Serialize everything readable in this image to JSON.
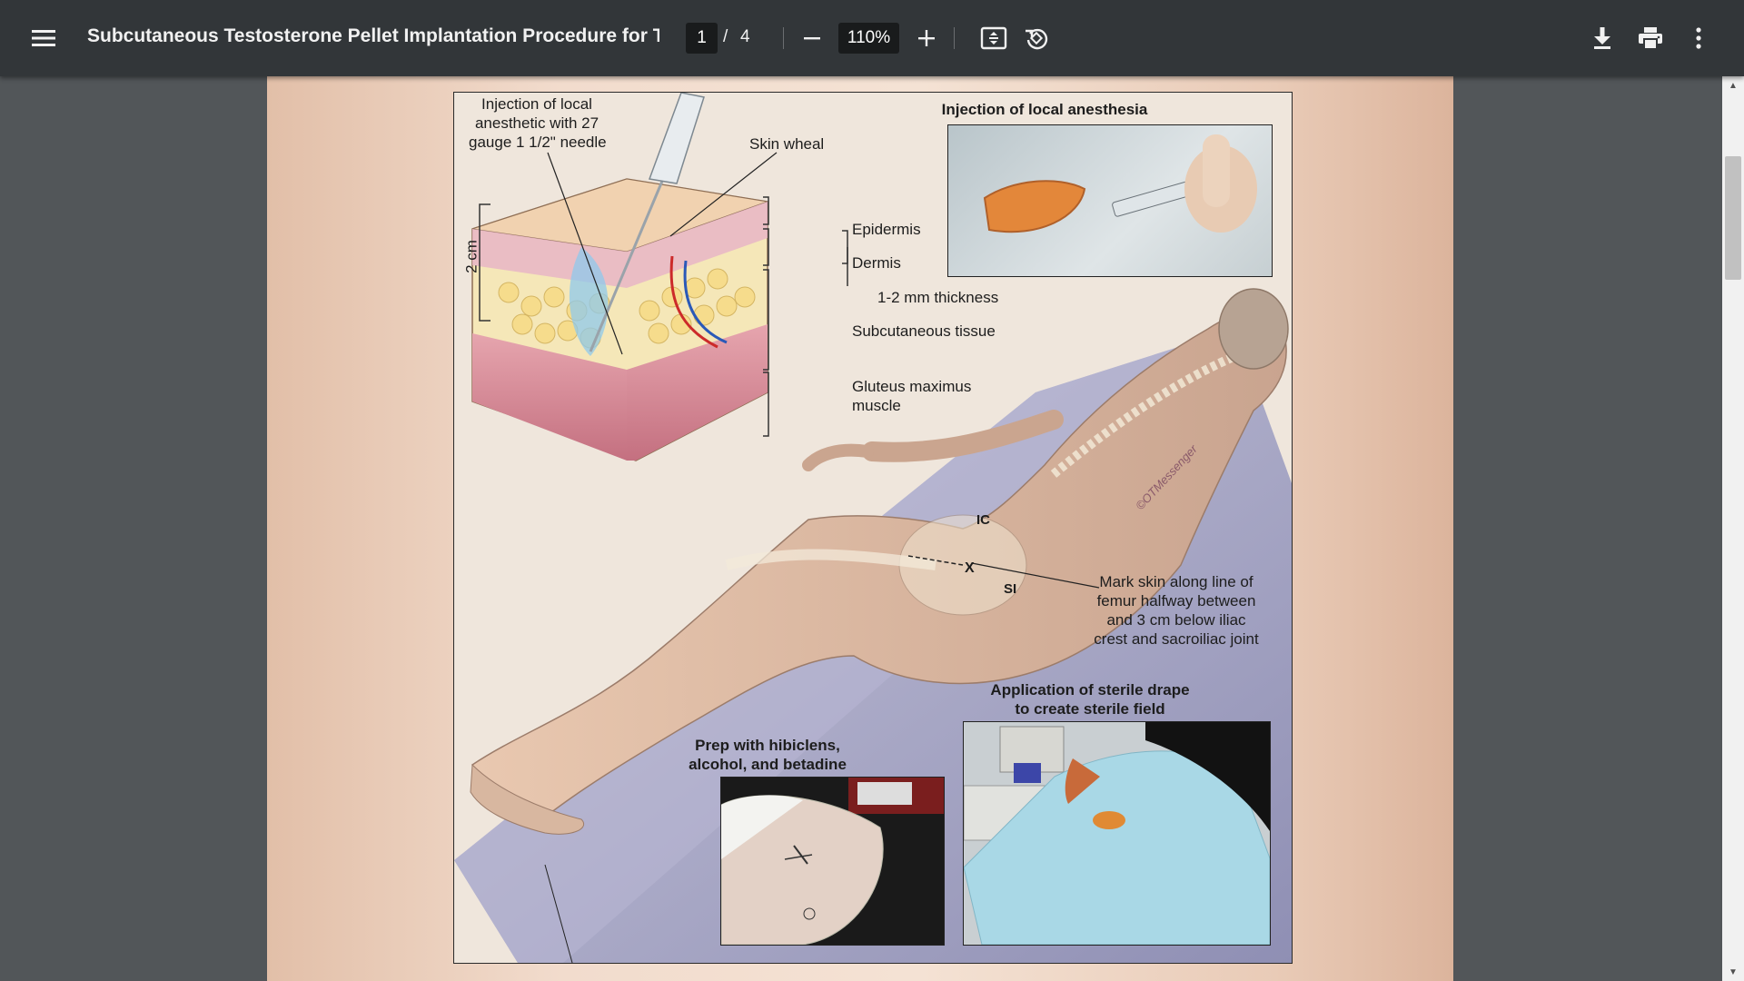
{
  "toolbar": {
    "menu_icon": "hamburger-menu-icon",
    "title": "Subcutaneous Testosterone Pellet Implantation Procedure for Tr...",
    "page_current": "1",
    "page_separator": "/",
    "page_total": "4",
    "zoom_out_icon": "minus-icon",
    "zoom_level": "110%",
    "zoom_in_icon": "plus-icon",
    "fit_icon": "fit-to-page-icon",
    "rotate_icon": "rotate-counterclockwise-icon",
    "download_icon": "download-icon",
    "print_icon": "print-icon",
    "more_icon": "more-vertical-icon"
  },
  "figure": {
    "labels": {
      "injection_needle": [
        "Injection of local",
        "anesthetic with 27",
        "gauge 1 1/2\" needle"
      ],
      "skin_wheal": "Skin wheal",
      "epidermis": "Epidermis",
      "dermis": "Dermis",
      "thickness": "1-2 mm thickness",
      "subcutaneous": "Subcutaneous tissue",
      "gluteus": [
        "Gluteus maximus",
        "muscle"
      ],
      "two_cm": "2 cm",
      "ic": "IC",
      "x_mark": "X",
      "si": "SI",
      "mark_skin": [
        "Mark skin along line of",
        "femur halfway between",
        "and 3 cm below iliac",
        "crest and sacroiliac joint"
      ],
      "copyright": "©OTMessenger"
    },
    "photo_titles": {
      "anesthesia": "Injection of local anesthesia",
      "drape": [
        "Application of sterile drape",
        "to create sterile field"
      ],
      "prep": [
        "Prep with hibiclens,",
        "alcohol, and betadine"
      ]
    }
  },
  "colors": {
    "toolbar_bg": "#323639",
    "viewer_bg": "#525659",
    "page_bg": "#f2dccd"
  }
}
